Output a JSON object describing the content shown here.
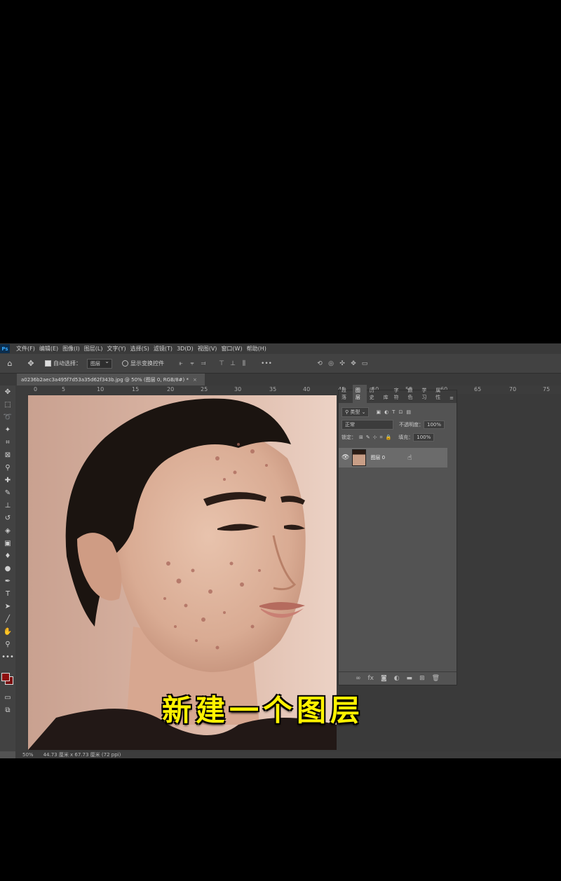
{
  "app": {
    "logo": "Ps"
  },
  "menu": [
    "文件(F)",
    "编辑(E)",
    "图像(I)",
    "图层(L)",
    "文字(Y)",
    "选择(S)",
    "滤镜(T)",
    "3D(D)",
    "视图(V)",
    "窗口(W)",
    "帮助(H)"
  ],
  "options_bar": {
    "auto_select_label": "自动选择：",
    "auto_select_value": "图层",
    "show_transform_label": "显示变换控件"
  },
  "document": {
    "tab_title": "a0236b2aec3a495f7d53a35d62f343b.jpg @ 50% (图层 0, RGB/8#) *"
  },
  "ruler_ticks": [
    "0",
    "5",
    "10",
    "15",
    "20",
    "25",
    "30",
    "35",
    "40",
    "45",
    "50",
    "55",
    "60",
    "65",
    "70",
    "75"
  ],
  "layers_panel": {
    "tabs": [
      "段落",
      "图层",
      "历史",
      "库",
      "字符",
      "颜色",
      "学习",
      "属性"
    ],
    "filter_label": "类型",
    "blend_mode": "正常",
    "opacity_label": "不透明度：",
    "opacity_value": "100%",
    "lock_label": "锁定：",
    "fill_label": "填充：",
    "fill_value": "100%",
    "layer_name": "图层 0"
  },
  "status": {
    "zoom": "50%",
    "dimensions": "44.73 厘米 x 67.73 厘米 (72 ppi)"
  },
  "subtitle": "新建一个图层",
  "colors": {
    "foreground": "#8e0e0e",
    "background": "#7a0c0c",
    "subtitle": "#fff200"
  }
}
